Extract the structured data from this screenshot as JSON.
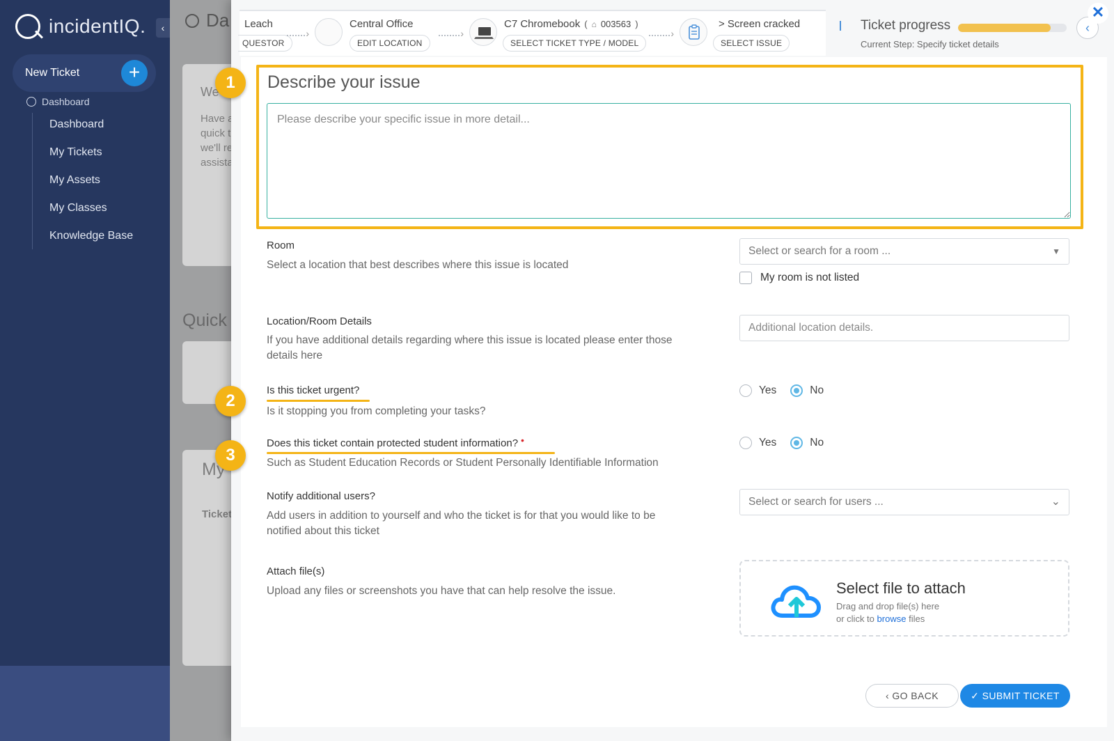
{
  "app": {
    "logo_text": "incidentIQ.",
    "collapse_glyph": "‹"
  },
  "sidebar": {
    "new_ticket_label": "New Ticket",
    "new_ticket_plus": "+",
    "section_label": "Dashboard",
    "items": [
      {
        "label": "Dashboard"
      },
      {
        "label": "My Tickets"
      },
      {
        "label": "My Assets"
      },
      {
        "label": "My Classes"
      },
      {
        "label": "Knowledge Base"
      }
    ]
  },
  "background": {
    "header_title": "Da",
    "welcome_fragment": "We",
    "welcome_lines": [
      "Have a",
      "quick t",
      "we'll re",
      "assista"
    ],
    "quick_title": "Quick T",
    "my_title": "My",
    "ticket_col": "Ticket"
  },
  "wizard": {
    "steps": [
      {
        "title": "Leach",
        "button": "QUESTOR"
      },
      {
        "title": "Central Office",
        "button": "EDIT LOCATION"
      },
      {
        "title": "C7 Chromebook",
        "tag_open": "(",
        "asset_tag": "003563",
        "tag_close": ")",
        "button": "SELECT TICKET TYPE / MODEL"
      },
      {
        "title": "> Screen cracked",
        "button": "SELECT ISSUE"
      }
    ]
  },
  "progress": {
    "title": "Ticket progress",
    "current_step": "Current Step:  Specify ticket details",
    "fraction": 0.85,
    "fill_color": "#f2c14e"
  },
  "close_glyph": "✕",
  "panel_toggle_glyph": "‹",
  "issue": {
    "title": "Describe your issue",
    "placeholder": "Please describe your specific issue in more detail..."
  },
  "callouts": [
    "1",
    "2",
    "3"
  ],
  "form": {
    "room": {
      "label": "Room",
      "desc": "Select a location that best describes where this issue is located",
      "placeholder": "Select or search for a room ...",
      "caret": "▼",
      "not_listed": "My room is not listed"
    },
    "location_details": {
      "label": "Location/Room Details",
      "desc": "If you have additional details regarding where this issue is located please enter those details here",
      "placeholder": "Additional location details."
    },
    "urgent": {
      "label": "Is this ticket urgent?",
      "desc": "Is it stopping you from completing your tasks?",
      "yes": "Yes",
      "no": "No",
      "selected": "No"
    },
    "protected": {
      "label": "Does this ticket contain protected student information?",
      "required_mark": "•",
      "desc": "Such as Student Education Records or Student Personally Identifiable Information",
      "yes": "Yes",
      "no": "No",
      "selected": "No"
    },
    "notify": {
      "label": "Notify additional users?",
      "desc": "Add users in addition to yourself and who the ticket is for that you would like to be notified about this ticket",
      "placeholder": "Select or search for users ...",
      "caret": "⌄"
    },
    "attach": {
      "label": "Attach file(s)",
      "desc": "Upload any files or screenshots you have that can help resolve the issue.",
      "drop_title": "Select file to attach",
      "drop_line1": "Drag and drop file(s) here",
      "drop_line2_prefix": "or click to",
      "drop_link": "browse",
      "drop_line2_suffix": "files"
    }
  },
  "footer": {
    "back_label": "‹  GO BACK",
    "submit_label": "✓  SUBMIT TICKET"
  },
  "colors": {
    "accent": "#1e88e5",
    "highlight": "#f4b416",
    "sidebar": "#26375f",
    "radio": "#5fb7e5"
  }
}
